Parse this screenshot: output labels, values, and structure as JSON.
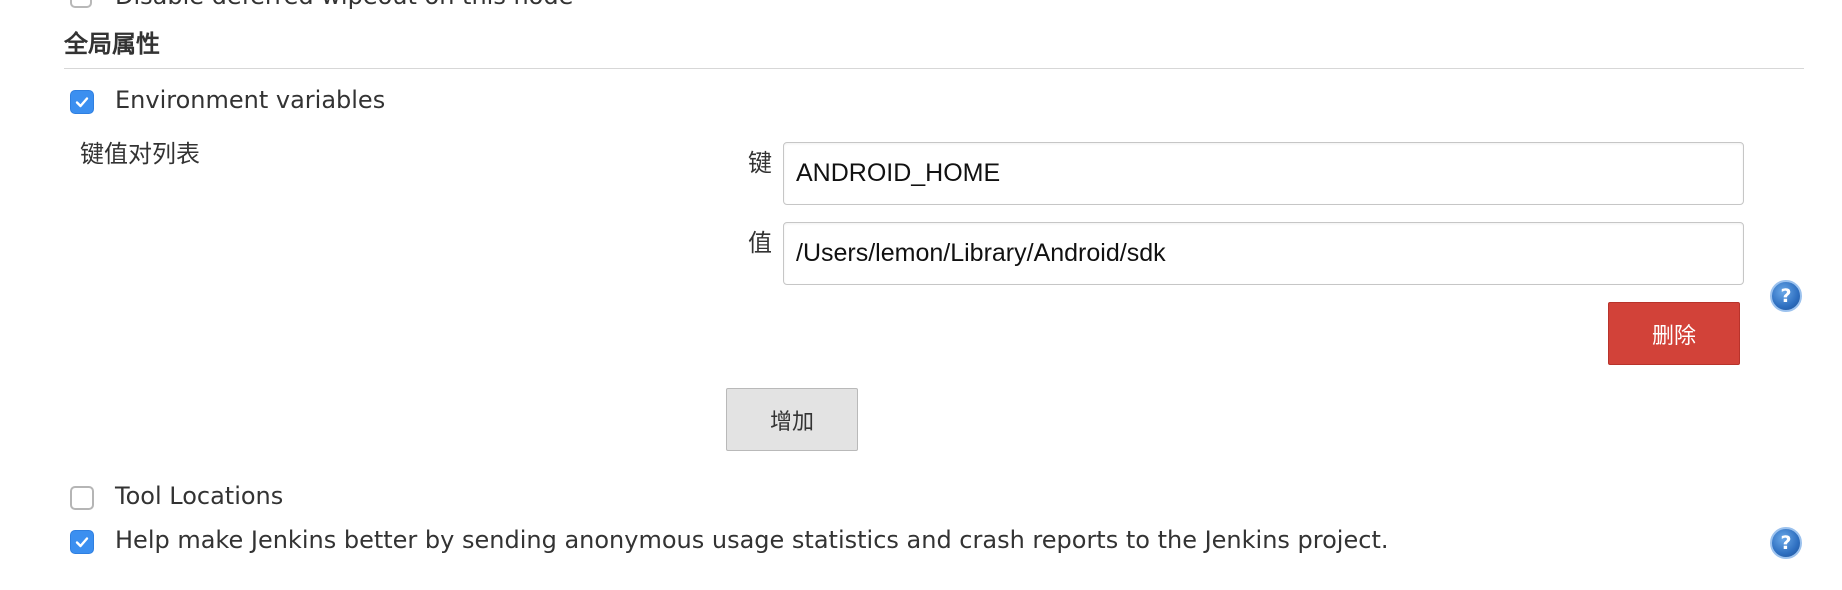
{
  "top_row": {
    "label": "Disable deferred wipeout on this node"
  },
  "section": {
    "title": "全局属性"
  },
  "env_vars": {
    "checked": true,
    "label": "Environment variables",
    "list_label": "键值对列表",
    "key_label": "键",
    "key_value": "ANDROID_HOME",
    "value_label": "值",
    "value_value": "/Users/lemon/Library/Android/sdk",
    "delete_button": "删除",
    "add_button": "增加",
    "help_icon": "?"
  },
  "tool_locations": {
    "checked": false,
    "label": "Tool Locations"
  },
  "usage_stats": {
    "checked": true,
    "label": "Help make Jenkins better by sending anonymous usage statistics and crash reports to the Jenkins project.",
    "help_icon": "?"
  },
  "colors": {
    "checkbox_checked": "#3b8ff0",
    "delete_button": "#d24239",
    "add_button": "#e3e3e3",
    "help_icon": "#2e6fc0"
  }
}
